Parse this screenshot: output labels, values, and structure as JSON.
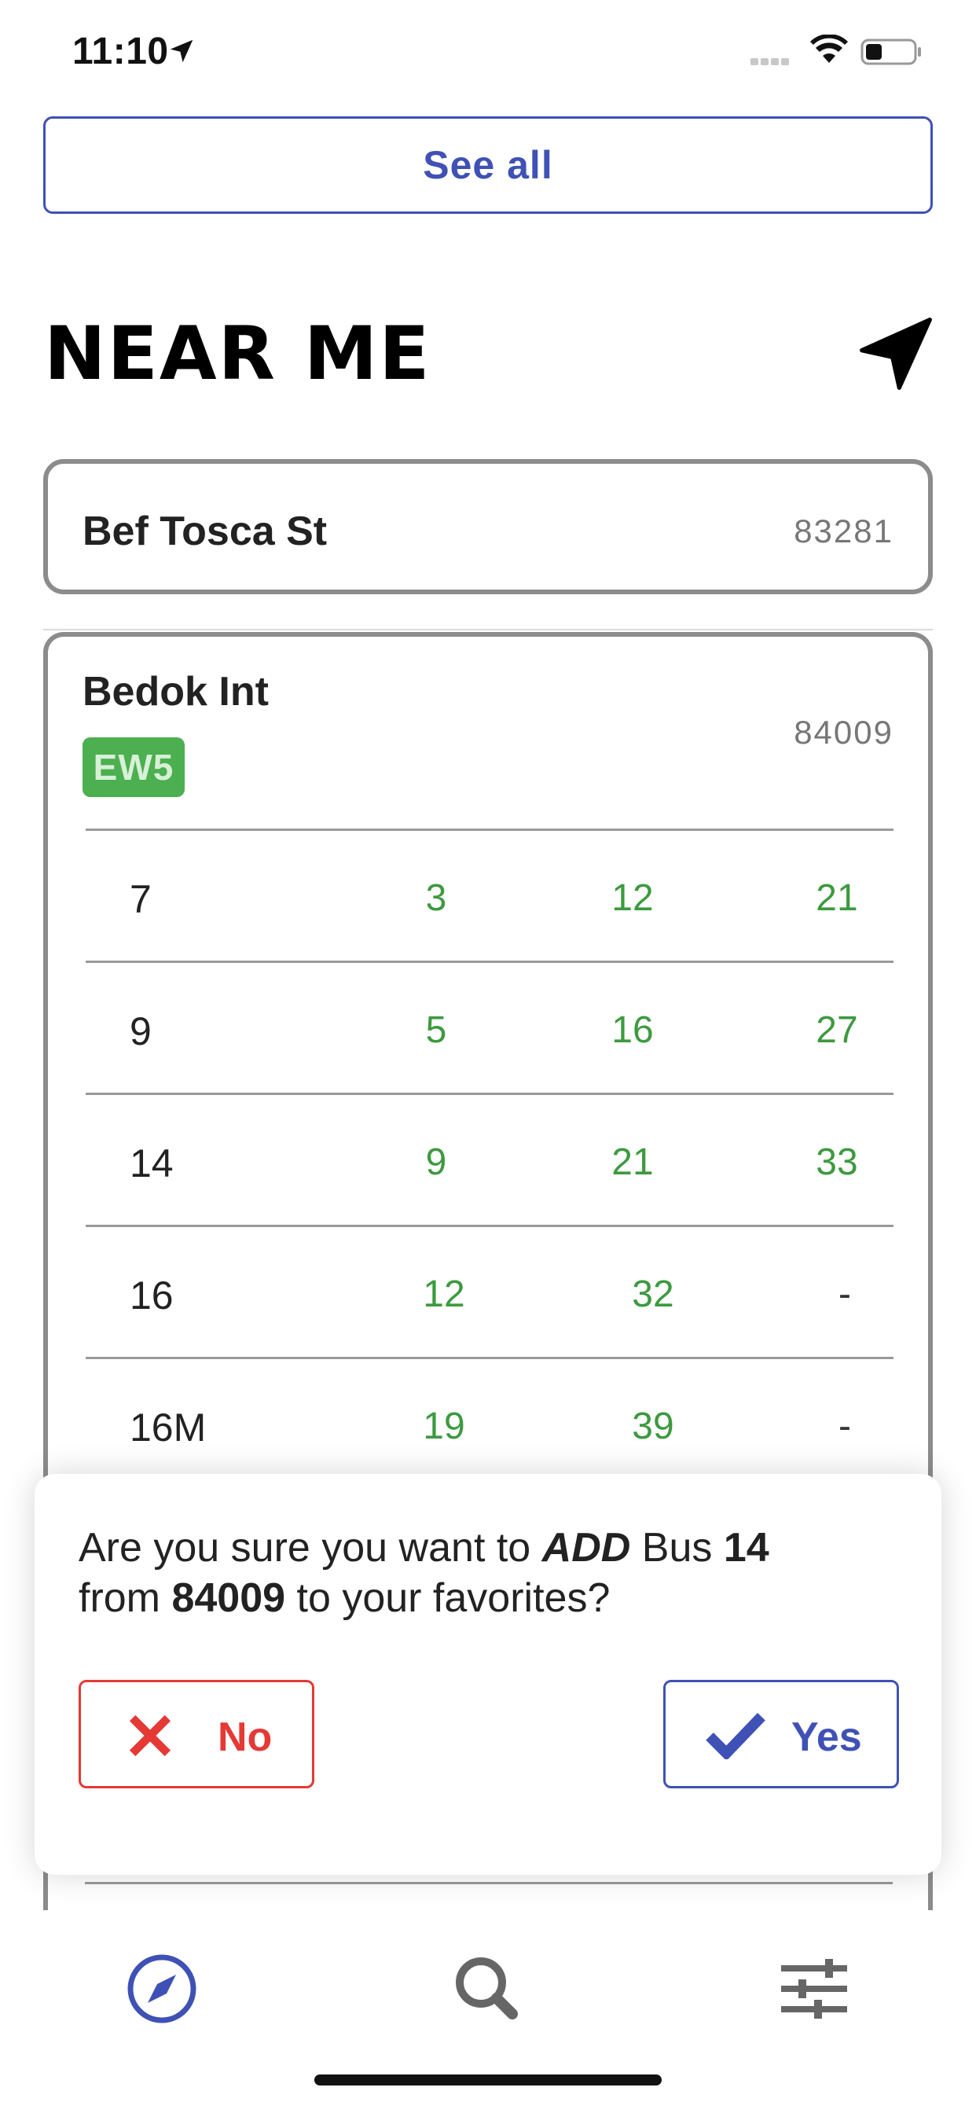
{
  "status_bar": {
    "time": "11:10"
  },
  "see_all": {
    "label": "See all"
  },
  "near_me": {
    "title": "NEAR ME"
  },
  "stops": [
    {
      "name": "Bef Tosca St",
      "code": "83281"
    },
    {
      "name": "Bedok Int",
      "code": "84009",
      "mrt_badge": "EW5",
      "services": [
        {
          "service": "7",
          "etas": [
            "3",
            "12",
            "21"
          ]
        },
        {
          "service": "9",
          "etas": [
            "5",
            "16",
            "27"
          ]
        },
        {
          "service": "14",
          "etas": [
            "9",
            "21",
            "33"
          ]
        },
        {
          "service": "16",
          "etas": [
            "12",
            "32",
            "-"
          ]
        },
        {
          "service": "16M",
          "etas": [
            "19",
            "39",
            "-"
          ]
        }
      ]
    }
  ],
  "dialog": {
    "text_1": "Are you sure you want to ",
    "action": "ADD",
    "text_2": " Bus ",
    "bus": "14",
    "text_3": "from ",
    "stop_code": "84009",
    "text_4": " to your favorites?",
    "no_label": "No",
    "yes_label": "Yes"
  },
  "tab_bar": {
    "tabs": [
      {
        "icon": "compass-icon",
        "active": true
      },
      {
        "icon": "search-icon",
        "active": false
      },
      {
        "icon": "sliders-icon",
        "active": false
      }
    ]
  },
  "colors": {
    "accent": "#3f51b5",
    "eta_green": "#3d9a3f",
    "danger": "#e53935",
    "mrt_green": "#4caf50"
  }
}
